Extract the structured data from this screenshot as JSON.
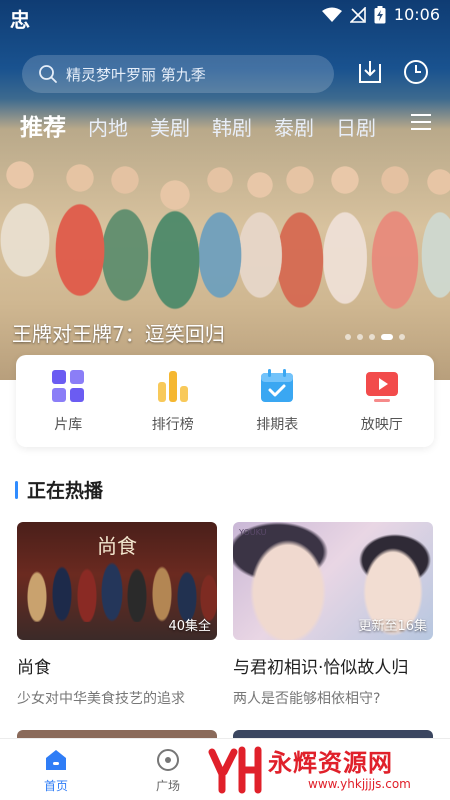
{
  "status_bar": {
    "app_icon": "忠",
    "time": "10:06",
    "icons": [
      "wifi-icon",
      "no-signal-icon",
      "battery-charging-icon"
    ]
  },
  "header": {
    "search_placeholder": "精灵梦叶罗丽 第九季",
    "icons": [
      "download-icon",
      "history-clock-icon"
    ]
  },
  "tabs": [
    {
      "label": "推荐",
      "active": true
    },
    {
      "label": "内地",
      "active": false
    },
    {
      "label": "美剧",
      "active": false
    },
    {
      "label": "韩剧",
      "active": false
    },
    {
      "label": "泰剧",
      "active": false
    },
    {
      "label": "日剧",
      "active": false
    }
  ],
  "banner": {
    "title": "王牌对王牌7：逗笑回归",
    "dots_total": 5,
    "dots_active_index": 3
  },
  "quick_entries": [
    {
      "label": "片库",
      "icon": "grid-library-icon",
      "color": "#6b5cf2"
    },
    {
      "label": "排行榜",
      "icon": "bar-ranking-icon",
      "color": "#f5b731"
    },
    {
      "label": "排期表",
      "icon": "calendar-check-icon",
      "color": "#3aa7f2"
    },
    {
      "label": "放映厅",
      "icon": "play-screen-icon",
      "color": "#f24b4b"
    }
  ],
  "section": {
    "title": "正在热播"
  },
  "cards": [
    {
      "title": "尚食",
      "desc": "少女对中华美食技艺的追求",
      "badge": "40集全",
      "thumb_logo": "尚食"
    },
    {
      "title": "与君初相识·恰似故人归",
      "desc": "两人是否能够相依相守?",
      "badge": "更新至16集",
      "thumb_brand": "YOUKU"
    }
  ],
  "bottom_nav": [
    {
      "label": "首页",
      "icon": "home-icon",
      "active": true
    },
    {
      "label": "广场",
      "icon": "circle-plaza-icon",
      "active": false
    }
  ],
  "watermark": {
    "title": "永辉资源网",
    "url": "www.yhkjjjjs.com"
  },
  "colors": {
    "accent": "#2f8cff",
    "nav_active": "#2f7df6",
    "watermark_red": "#e0202a"
  }
}
